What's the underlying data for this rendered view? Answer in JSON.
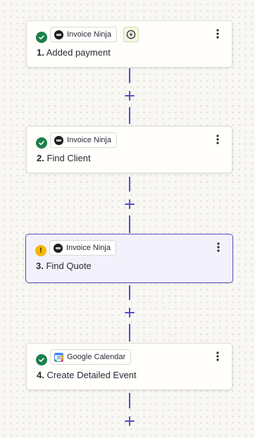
{
  "steps": [
    {
      "number": "1.",
      "title": "Added payment",
      "app": "Invoice Ninja",
      "app_icon": "invoice-ninja-icon",
      "status": "complete",
      "trigger": true
    },
    {
      "number": "2.",
      "title": "Find Client",
      "app": "Invoice Ninja",
      "app_icon": "invoice-ninja-icon",
      "status": "complete",
      "trigger": false
    },
    {
      "number": "3.",
      "title": "Find Quote",
      "app": "Invoice Ninja",
      "app_icon": "invoice-ninja-icon",
      "status": "warning",
      "trigger": false,
      "selected": true
    },
    {
      "number": "4.",
      "title": "Create Detailed Event",
      "app": "Google Calendar",
      "app_icon": "google-calendar-icon",
      "status": "complete",
      "trigger": false
    }
  ],
  "warning_glyph": "!",
  "colors": {
    "accent": "#5c4fc4",
    "success": "#1b7f4a",
    "warning": "#f5b800",
    "trigger": "#6a9c16"
  }
}
